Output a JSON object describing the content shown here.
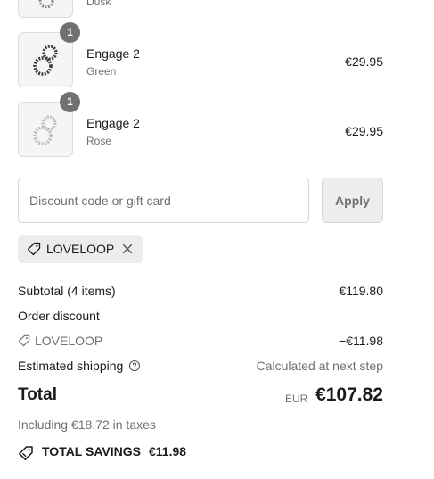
{
  "line_items": [
    {
      "name": "",
      "variant": "Dusk",
      "price": "",
      "quantity": ""
    },
    {
      "name": "Engage 2",
      "variant": "Green",
      "price": "€29.95",
      "quantity": "1"
    },
    {
      "name": "Engage 2",
      "variant": "Rose",
      "price": "€29.95",
      "quantity": "1"
    }
  ],
  "discount": {
    "placeholder": "Discount code or gift card",
    "value": "",
    "apply_label": "Apply",
    "applied_code": "LOVELOOP"
  },
  "summary": {
    "subtotal_label": "Subtotal (4 items)",
    "subtotal_value": "€119.80",
    "order_discount_label": "Order discount",
    "discount_code": "LOVELOOP",
    "discount_value": "−€11.98",
    "shipping_label": "Estimated shipping",
    "shipping_value": "Calculated at next step",
    "total_label": "Total",
    "currency": "EUR",
    "total_value": "€107.82",
    "taxes_text": "Including €18.72 in taxes",
    "savings_label": "TOTAL SAVINGS",
    "savings_value": "€11.98"
  },
  "colors": {
    "muted_text": "#707070",
    "badge_bg": "#707070",
    "pill_bg": "#ececec",
    "button_bg": "#ededed"
  },
  "icons": [
    "earring-image",
    "tag-icon",
    "close-icon",
    "info-icon",
    "savings-tag-icon"
  ]
}
